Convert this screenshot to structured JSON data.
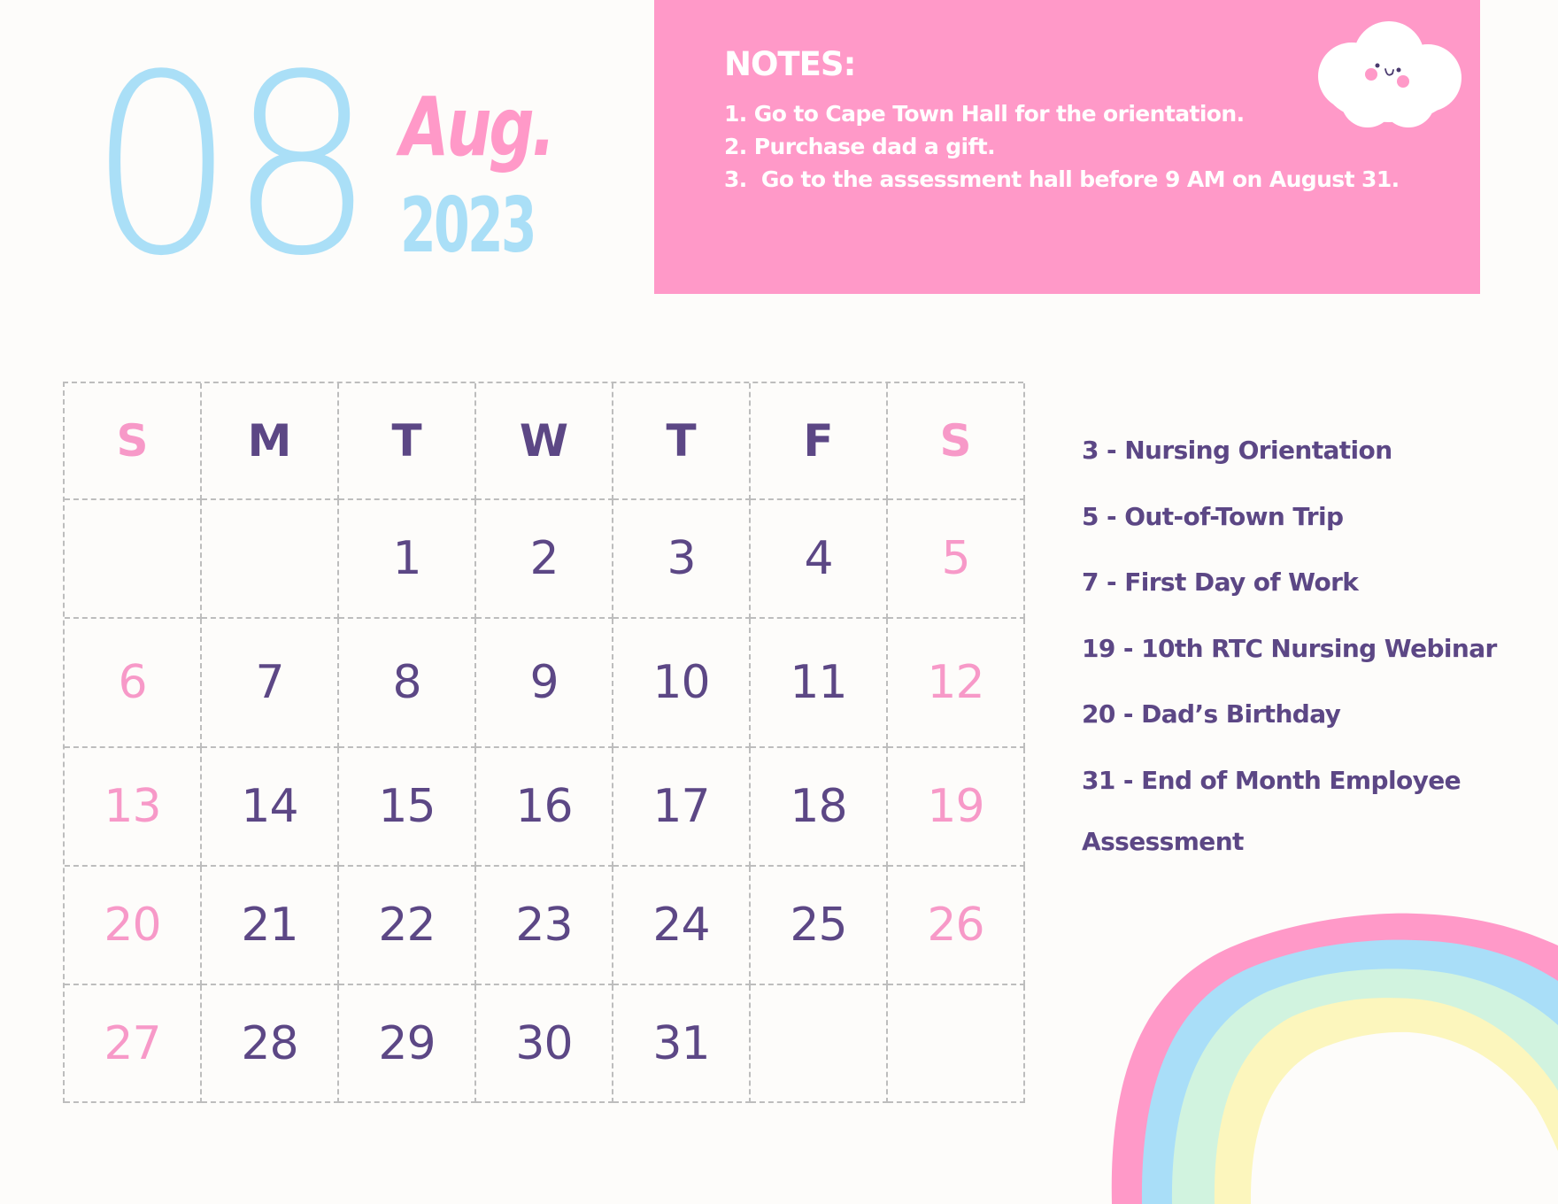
{
  "header": {
    "month_number": "08",
    "month_abbr": "Aug.",
    "year": "2023"
  },
  "notes": {
    "title": "NOTES:",
    "items": [
      "1. Go to Cape Town Hall for the orientation.",
      "2. Purchase dad a gift.",
      "3.  Go to the assessment hall before 9 AM on August 31."
    ]
  },
  "calendar": {
    "weekdays": [
      "S",
      "M",
      "T",
      "W",
      "T",
      "F",
      "S"
    ],
    "weeks": [
      [
        "",
        "",
        "1",
        "2",
        "3",
        "4",
        "5"
      ],
      [
        "6",
        "7",
        "8",
        "9",
        "10",
        "11",
        "12"
      ],
      [
        "13",
        "14",
        "15",
        "16",
        "17",
        "18",
        "19"
      ],
      [
        "20",
        "21",
        "22",
        "23",
        "24",
        "25",
        "26"
      ],
      [
        "27",
        "28",
        "29",
        "30",
        "31",
        "",
        ""
      ]
    ]
  },
  "events": [
    "3 - Nursing Orientation",
    "5 - Out-of-Town Trip",
    "7 - First Day of Work",
    "19 - 10th RTC Nursing Webinar",
    "20 - Dad’s Birthday",
    "31 - End of Month Employee",
    "Assessment"
  ],
  "colors": {
    "pink": "#ff99c8",
    "blue": "#aadff7",
    "mint": "#d1f3df",
    "yellow": "#fcf6bd",
    "purple": "#5c4785",
    "background": "#fdfcfa"
  }
}
